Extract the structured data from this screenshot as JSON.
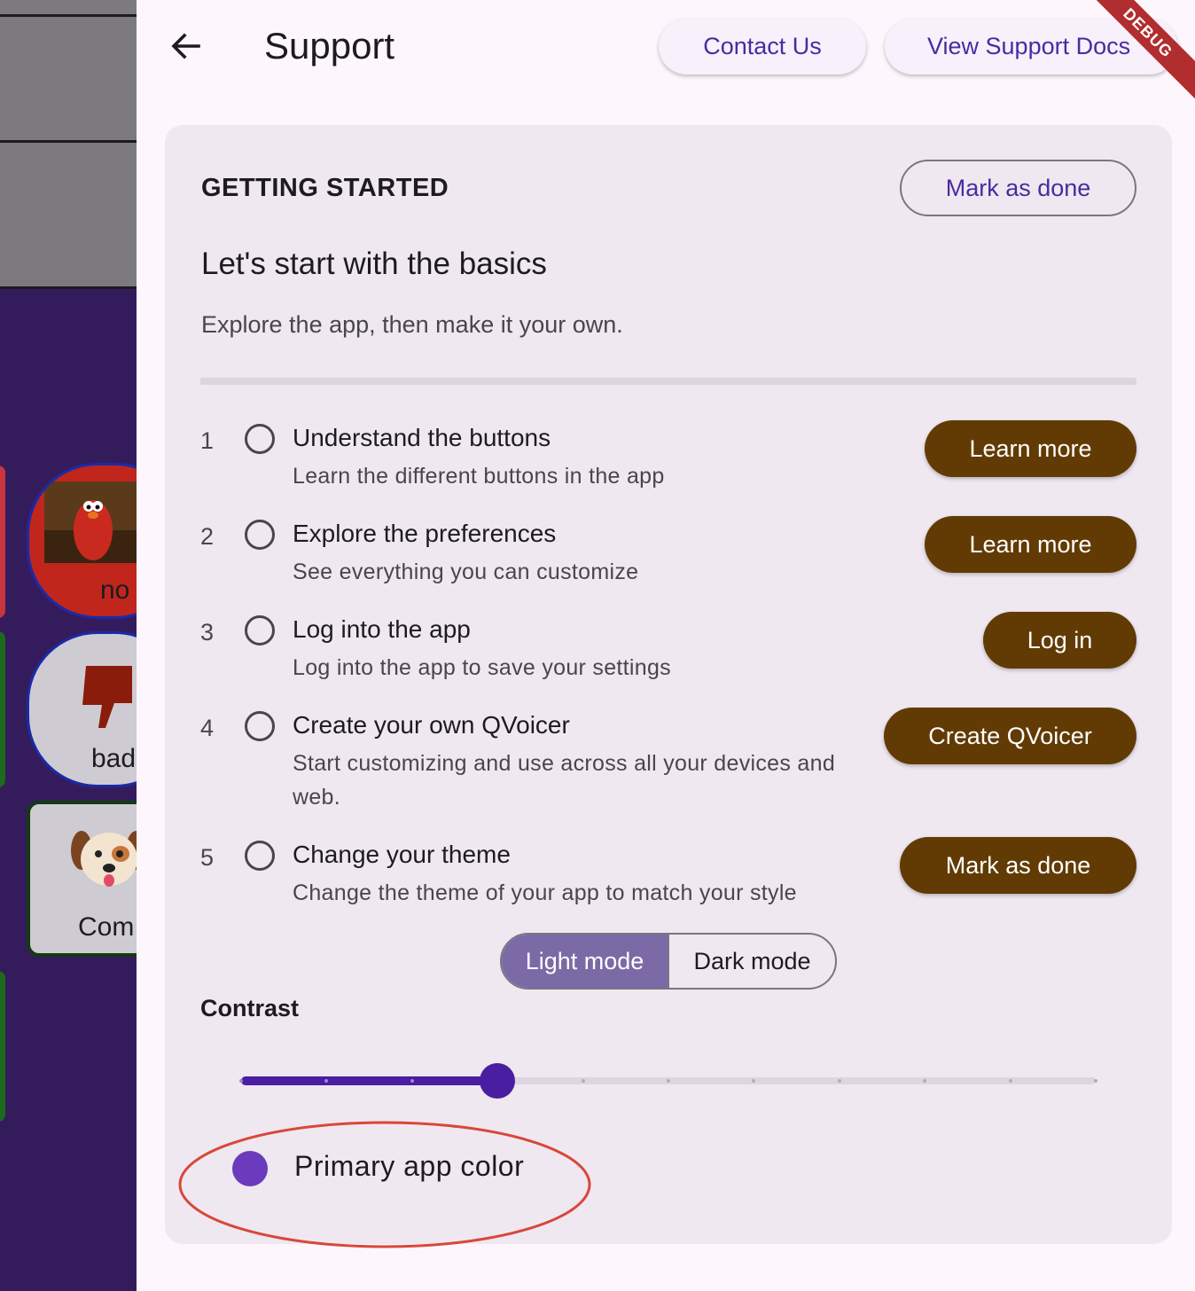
{
  "header": {
    "title": "Support",
    "contact_label": "Contact Us",
    "docs_label": "View Support Docs",
    "back_icon": "arrow-left-icon",
    "debug_banner": "DEBUG"
  },
  "background_app": {
    "tiles": [
      {
        "label": "no",
        "icon": "elmo-photo"
      },
      {
        "label": "bad",
        "icon": "thumbs-down-icon"
      },
      {
        "label": "Com",
        "icon": "puppy-face-icon"
      }
    ]
  },
  "card": {
    "heading": "GETTING STARTED",
    "mark_done_label": "Mark as done",
    "subtitle": "Let's start with the basics",
    "description": "Explore the app, then make it your own.",
    "steps": [
      {
        "number": "1",
        "title": "Understand the buttons",
        "subtitle": "Learn the different buttons in the app",
        "button": "Learn more"
      },
      {
        "number": "2",
        "title": "Explore the preferences",
        "subtitle": "See everything you can customize",
        "button": "Learn more"
      },
      {
        "number": "3",
        "title": "Log into the app",
        "subtitle": "Log into the app to save your settings",
        "button": "Log in"
      },
      {
        "number": "4",
        "title": "Create your own QVoicer",
        "subtitle": "Start customizing and use across all your devices and web.",
        "button": "Create QVoicer"
      },
      {
        "number": "5",
        "title": "Change your theme",
        "subtitle": "Change the theme of your app to match your style",
        "button": "Mark as done"
      }
    ],
    "theme_modes": {
      "light": "Light mode",
      "dark": "Dark mode",
      "selected": "light"
    },
    "contrast": {
      "label": "Contrast",
      "value": 3,
      "min": 0,
      "max": 10,
      "divisions": 10
    },
    "primary_color": {
      "label": "Primary app color",
      "color": "#6a3bbc"
    }
  },
  "colors": {
    "accent": "#4a2ba0",
    "step_button": "#623b04",
    "card_bg": "#efe8f0",
    "highlight_ring": "#d9473a"
  }
}
